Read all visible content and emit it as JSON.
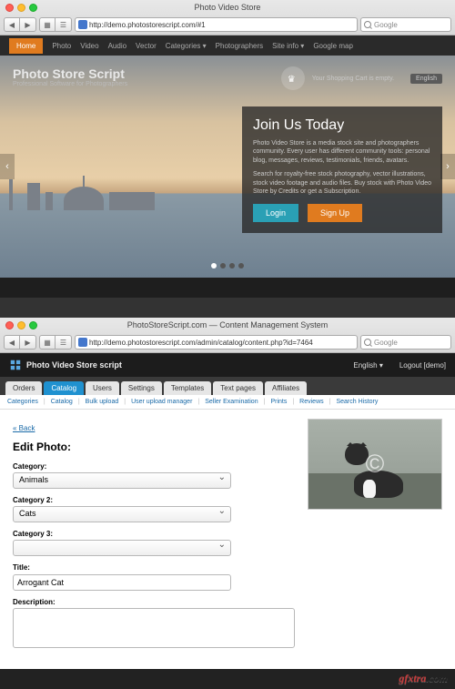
{
  "window1": {
    "title": "Photo Video Store",
    "url": "http://demo.photostorescript.com/#1",
    "search_placeholder": "Google",
    "nav": [
      "Home",
      "Photo",
      "Video",
      "Audio",
      "Vector",
      "Categories ▾",
      "Photographers",
      "Site info ▾",
      "Google map"
    ],
    "logo_title": "Photo Store Script",
    "logo_subtitle": "Professional Software for Photographers",
    "cart_text": "Your Shopping Cart is empty.",
    "lang": "English",
    "join_title": "Join Us Today",
    "join_p1": "Photo Video Store is a media stock site and photographers community. Every user has different community tools: personal blog, messages, reviews, testimonials, friends, avatars.",
    "join_p2": "Search for royalty-free stock photography, vector illustrations, stock video footage and audio files. Buy stock with Photo Video Store by Credits or get a Subscription.",
    "login_label": "Login",
    "signup_label": "Sign Up"
  },
  "window2": {
    "title": "PhotoStoreScript.com — Content Management System",
    "url": "http://demo.photostorescript.com/admin/catalog/content.php?id=7464",
    "search_placeholder": "Google",
    "brand": "Photo Video Store script",
    "lang": "English ▾",
    "logout": "Logout [demo]",
    "tabs": [
      "Orders",
      "Catalog",
      "Users",
      "Settings",
      "Templates",
      "Text pages",
      "Affiliates"
    ],
    "active_tab": "Catalog",
    "subtabs": [
      "Categories",
      "Catalog",
      "Bulk upload",
      "User upload manager",
      "Seller Examination",
      "Prints",
      "Reviews",
      "Search History"
    ],
    "back": "« Back",
    "page_title": "Edit Photo:",
    "labels": {
      "cat": "Category:",
      "cat2": "Category 2:",
      "cat3": "Category 3:",
      "title": "Title:",
      "desc": "Description:"
    },
    "values": {
      "cat": "Animals",
      "cat2": "Cats",
      "cat3": "",
      "title": "Arrogant Cat",
      "desc": ""
    },
    "watermark_symbol": "©"
  },
  "watermark": {
    "pre": "gfxtra",
    "post": ".com"
  }
}
